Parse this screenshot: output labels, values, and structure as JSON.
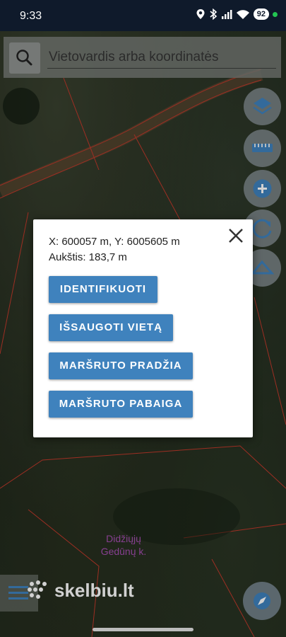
{
  "status_bar": {
    "time": "9:33",
    "battery": "92"
  },
  "search": {
    "placeholder": "Vietovardis arba koordinatės"
  },
  "map": {
    "place_label_line1": "Didžiųjų",
    "place_label_line2": "Gedūnų k."
  },
  "dialog": {
    "coordinates": "X: 600057 m, Y: 6005605 m",
    "altitude": "Aukštis: 183,7 m",
    "buttons": [
      "IDENTIFIKUOTI",
      "IŠSAUGOTI VIETĄ",
      "MARŠRUTO PRADŽIA",
      "MARŠRUTO PABAIGA"
    ]
  },
  "watermark": {
    "brand": "skelbiu.lt"
  },
  "colors": {
    "accent": "#3f82bd",
    "status_bar": "#0f1a2b",
    "place_label": "#a44db0",
    "parcel_lines": "#c0392b"
  },
  "icons": [
    "location-icon",
    "bluetooth-icon",
    "signal-icon",
    "wifi-icon",
    "search-icon",
    "layers-icon",
    "ruler-icon",
    "zoom-in-icon",
    "rotate-icon",
    "measure-area-icon",
    "close-icon",
    "menu-icon",
    "compass-icon"
  ]
}
